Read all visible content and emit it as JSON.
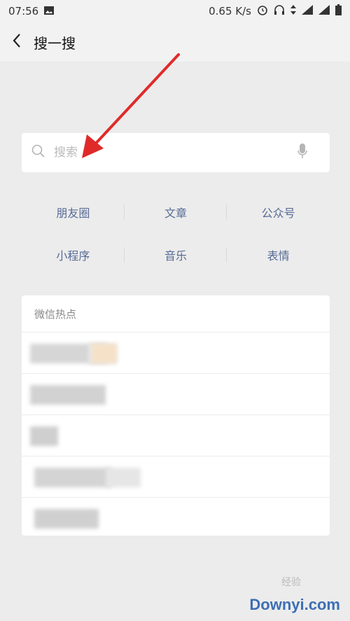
{
  "status_bar": {
    "time": "07:56",
    "network_speed": "0.65 K/s",
    "icons": [
      "image-icon",
      "alarm-icon",
      "headphones-icon",
      "data-arrows-icon",
      "signal-icon",
      "signal-icon",
      "battery-icon"
    ]
  },
  "header": {
    "title": "搜一搜"
  },
  "search": {
    "placeholder": "搜索"
  },
  "categories": [
    {
      "label": "朋友圈"
    },
    {
      "label": "文章"
    },
    {
      "label": "公众号"
    },
    {
      "label": "小程序"
    },
    {
      "label": "音乐"
    },
    {
      "label": "表情"
    }
  ],
  "hot_list": {
    "title": "微信热点",
    "rows": 5
  },
  "watermark": {
    "text": "Downyi.com",
    "sub": "经验"
  },
  "colors": {
    "accent_link": "#576b95",
    "arrow": "#e02a2a"
  }
}
